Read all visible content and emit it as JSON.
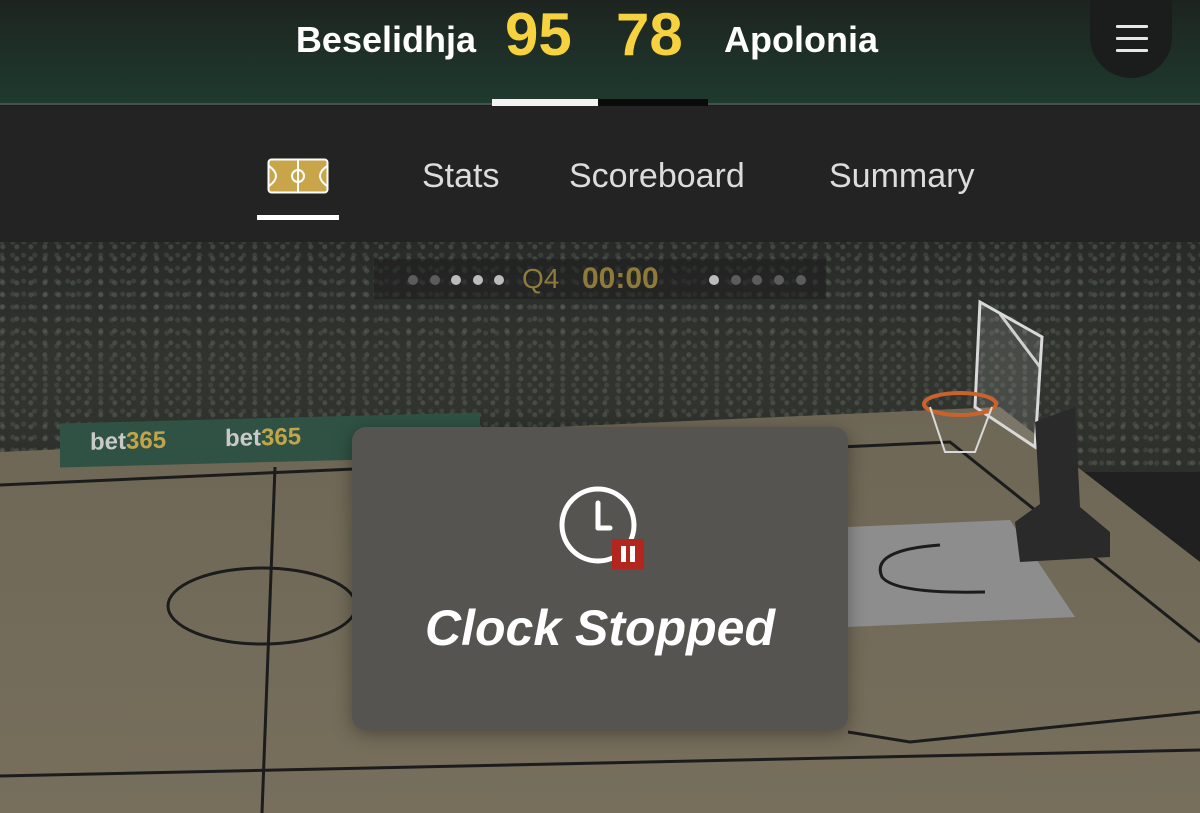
{
  "header": {
    "home_team": "Beselidhja",
    "home_score": "95",
    "away_score": "78",
    "away_team": "Apolonia",
    "menu_icon": "hamburger-menu-icon"
  },
  "tabs": {
    "court_icon": "court-icon",
    "items": [
      {
        "label": "Stats"
      },
      {
        "label": "Scoreboard"
      },
      {
        "label": "Summary"
      }
    ],
    "active": "court"
  },
  "court": {
    "quarter": "Q4",
    "clock": "00:00",
    "ad_text_a": "bet",
    "ad_text_b": "365",
    "home_dots_active": 3,
    "away_dots_active": 1
  },
  "overlay": {
    "icon": "clock-paused-icon",
    "label": "Clock Stopped"
  },
  "colors": {
    "score": "#f6d33e",
    "accent_gold": "#c2a54a",
    "pause_badge": "#b3261e"
  }
}
